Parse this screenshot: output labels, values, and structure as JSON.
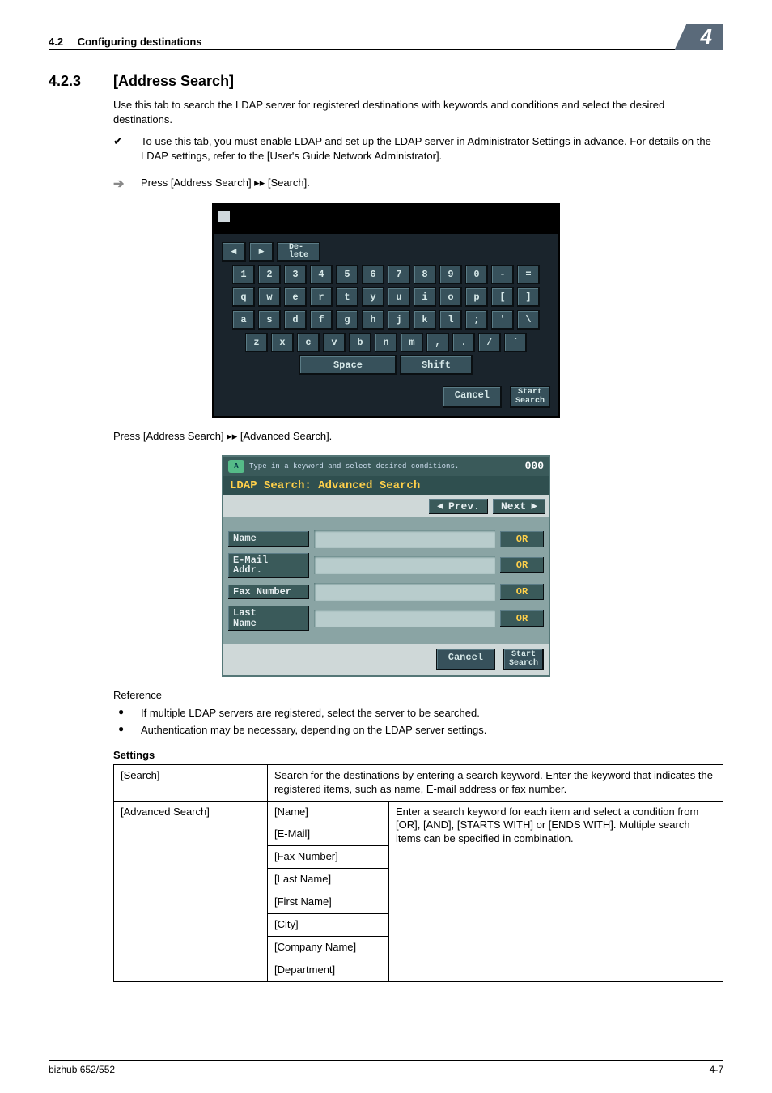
{
  "header": {
    "section_number": "4.2",
    "section_title": "Configuring destinations",
    "chapter": "4"
  },
  "section": {
    "number": "4.2.3",
    "title": "[Address Search]"
  },
  "intro": "Use this tab to search the LDAP server for registered destinations with keywords and conditions and select the desired destinations.",
  "note_check": "To use this tab, you must enable LDAP and set up the LDAP server in Administrator Settings in advance. For details on the LDAP settings, refer to the [User's Guide Network Administrator].",
  "step1": "Press [Address Search] ▸▸ [Search].",
  "keyboard": {
    "delete": "De-\nlete",
    "row1": [
      "1",
      "2",
      "3",
      "4",
      "5",
      "6",
      "7",
      "8",
      "9",
      "0",
      "-",
      "="
    ],
    "row2": [
      "q",
      "w",
      "e",
      "r",
      "t",
      "y",
      "u",
      "i",
      "o",
      "p",
      "[",
      "]"
    ],
    "row3": [
      "a",
      "s",
      "d",
      "f",
      "g",
      "h",
      "j",
      "k",
      "l",
      ";",
      "'",
      "\\"
    ],
    "row4": [
      "z",
      "x",
      "c",
      "v",
      "b",
      "n",
      "m",
      ",",
      ".",
      "/",
      "`"
    ],
    "space": "Space",
    "shift": "Shift",
    "cancel": "Cancel",
    "start": "Start\nSearch"
  },
  "step2": "Press [Address Search] ▸▸ [Advanced Search].",
  "adv": {
    "hint": "Type in a keyword and select desired conditions.",
    "count": "000",
    "title": "LDAP Search: Advanced Search",
    "prev": "Prev.",
    "next": "Next",
    "rows": [
      {
        "label": "Name",
        "cond": "OR"
      },
      {
        "label": "E-Mail\nAddr.",
        "cond": "OR"
      },
      {
        "label": "Fax Number",
        "cond": "OR"
      },
      {
        "label": "Last\nName",
        "cond": "OR"
      }
    ],
    "cancel": "Cancel",
    "start": "Start\nSearch"
  },
  "reference": {
    "heading": "Reference",
    "items": [
      "If multiple LDAP servers are registered, select the server to be searched.",
      "Authentication may be necessary, depending on the LDAP server settings."
    ]
  },
  "settings": {
    "title": "Settings",
    "search_label": "[Search]",
    "search_desc": "Search for the destinations by entering a search keyword. Enter the keyword that indicates the registered items, such as name, E-mail address or fax number.",
    "adv_label": "[Advanced Search]",
    "adv_items": [
      "[Name]",
      "[E-Mail]",
      "[Fax Number]",
      "[Last Name]",
      "[First Name]",
      "[City]",
      "[Company Name]",
      "[Department]"
    ],
    "adv_desc": "Enter a search keyword for each item and select a condition from [OR], [AND], [STARTS WITH] or [ENDS WITH]. Multiple search items can be specified in combination."
  },
  "footer": {
    "left": "bizhub 652/552",
    "right": "4-7"
  }
}
